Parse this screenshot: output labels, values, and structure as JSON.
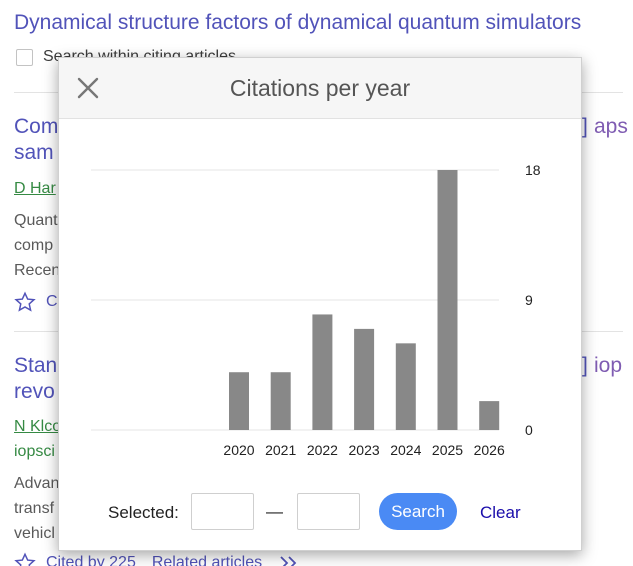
{
  "page": {
    "title": "Dynamical structure factors of dynamical quantum simulators",
    "search_within_label": "Search within citing articles"
  },
  "results": [
    {
      "title_visible": "Com",
      "title_line2": "sam",
      "tag": "]",
      "source": "aps",
      "author": "D Har",
      "lines": [
        "Quant",
        "comp",
        "Recen"
      ],
      "footer_link": "C"
    },
    {
      "title_visible": "Stan",
      "title_line2": "revo",
      "tag": "]",
      "source": "iop",
      "author": "N Klco",
      "lines": [
        "iopsci",
        "",
        "Advan",
        "transf",
        "vehicl"
      ],
      "footer_links": [
        "Cited by 225",
        "Related articles"
      ]
    }
  ],
  "modal": {
    "title": "Citations per year",
    "selected_label": "Selected:",
    "dash": "—",
    "from_value": "",
    "to_value": "",
    "search_label": "Search",
    "clear_label": "Clear"
  },
  "chart_data": {
    "type": "bar",
    "categories": [
      "2020",
      "2021",
      "2022",
      "2023",
      "2024",
      "2025",
      "2026"
    ],
    "values": [
      4,
      4,
      8,
      7,
      6,
      18,
      2
    ],
    "y_ticks": [
      "0",
      "9",
      "18"
    ],
    "ylim": [
      0,
      18
    ],
    "grid": true,
    "y_axis_side": "right",
    "bar_color": "#888888",
    "title": "",
    "xlabel": "",
    "ylabel": ""
  }
}
